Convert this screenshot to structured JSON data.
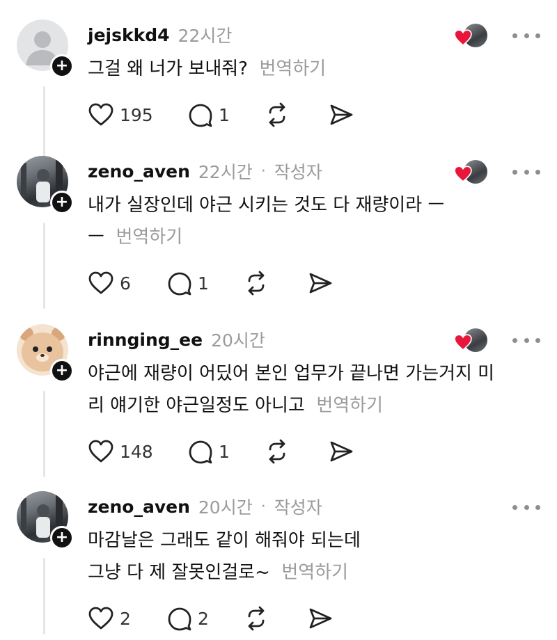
{
  "posts": [
    {
      "username": "jejskkd4",
      "time": "22시간",
      "author": "",
      "text": "그걸 왜 너가 보내줘?",
      "translate": "번역하기",
      "likes": "195",
      "replies": "1"
    },
    {
      "username": "zeno_aven",
      "time": "22시간",
      "author": "작성자",
      "text": "내가 실장인데 야근 시키는 것도 다 재량이라 ㅡ\nㅡ",
      "translate": "번역하기",
      "likes": "6",
      "replies": "1"
    },
    {
      "username": "rinnging_ee",
      "time": "20시간",
      "author": "",
      "text": "야근에 재량이 어딨어 본인 업무가 끝나면 가는거지 미\n리 얘기한 야근일정도 아니고",
      "translate": "번역하기",
      "likes": "148",
      "replies": "1"
    },
    {
      "username": "zeno_aven",
      "time": "20시간",
      "author": "작성자",
      "text": "마감날은 그래도 같이 해줘야 되는데\n그냥 다 제 잘못인걸로~",
      "translate": "번역하기",
      "likes": "2",
      "replies": "2"
    }
  ],
  "icons": {
    "like": "heart-outline-icon",
    "reply": "comment-bubble-icon",
    "repost": "repost-arrows-icon",
    "share": "send-icon",
    "more": "more-horizontal-icon"
  },
  "colors": {
    "heart": "#e8163a",
    "muted": "#9b9b9b"
  }
}
